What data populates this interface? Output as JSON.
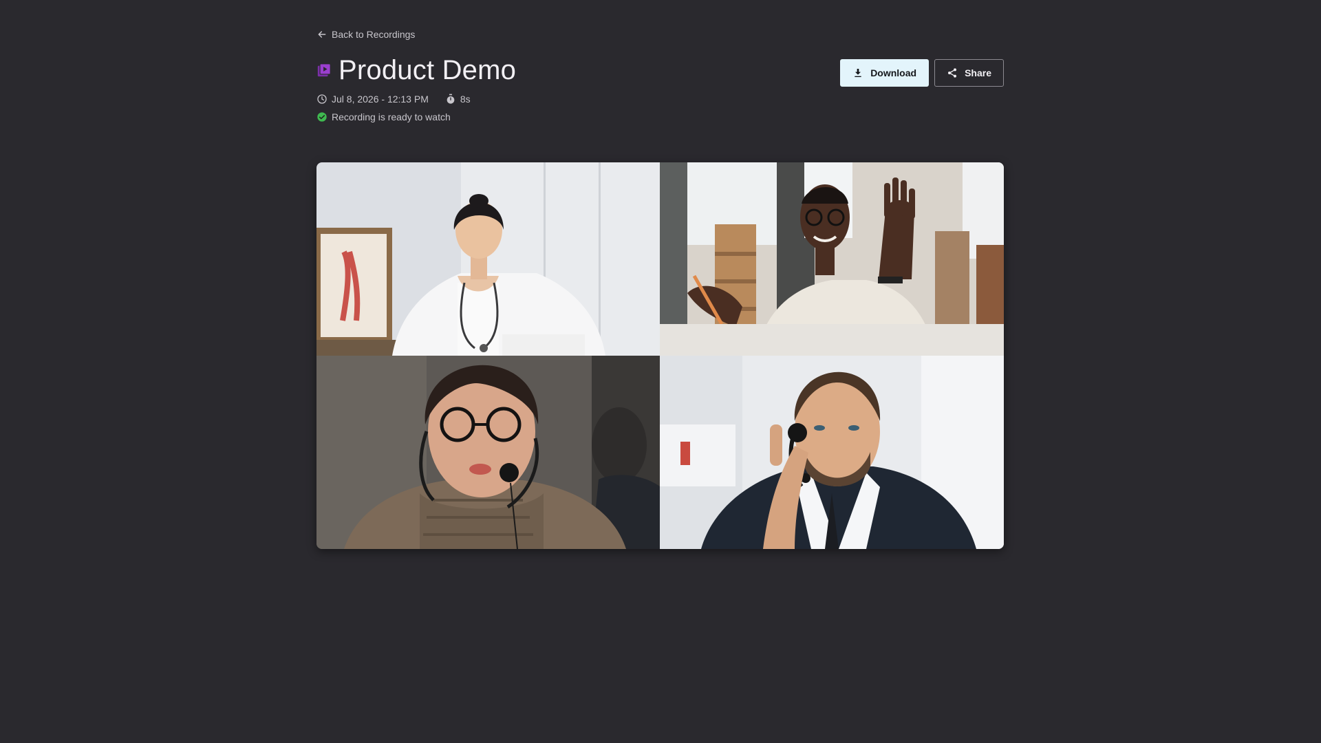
{
  "nav": {
    "back_label": "Back to Recordings"
  },
  "recording": {
    "title": "Product Demo",
    "date": "Jul 8, 2026 - 12:13 PM",
    "duration": "8s",
    "status": "Recording is ready to watch"
  },
  "actions": {
    "download_label": "Download",
    "share_label": "Share"
  },
  "icons": {
    "back": "arrow-left-icon",
    "recording": "video-library-icon",
    "download": "download-icon",
    "share": "share-icon",
    "date": "clock-icon",
    "duration": "timer-icon",
    "status": "check-circle-icon"
  },
  "colors": {
    "background": "#2a292e",
    "accent": "#7b2fa8",
    "download_button": "#e3f4fb",
    "success": "#3fb950"
  },
  "participants": [
    {
      "tile": "video-tile-top-left"
    },
    {
      "tile": "video-tile-top-right"
    },
    {
      "tile": "video-tile-bottom-left"
    },
    {
      "tile": "video-tile-bottom-right"
    }
  ]
}
